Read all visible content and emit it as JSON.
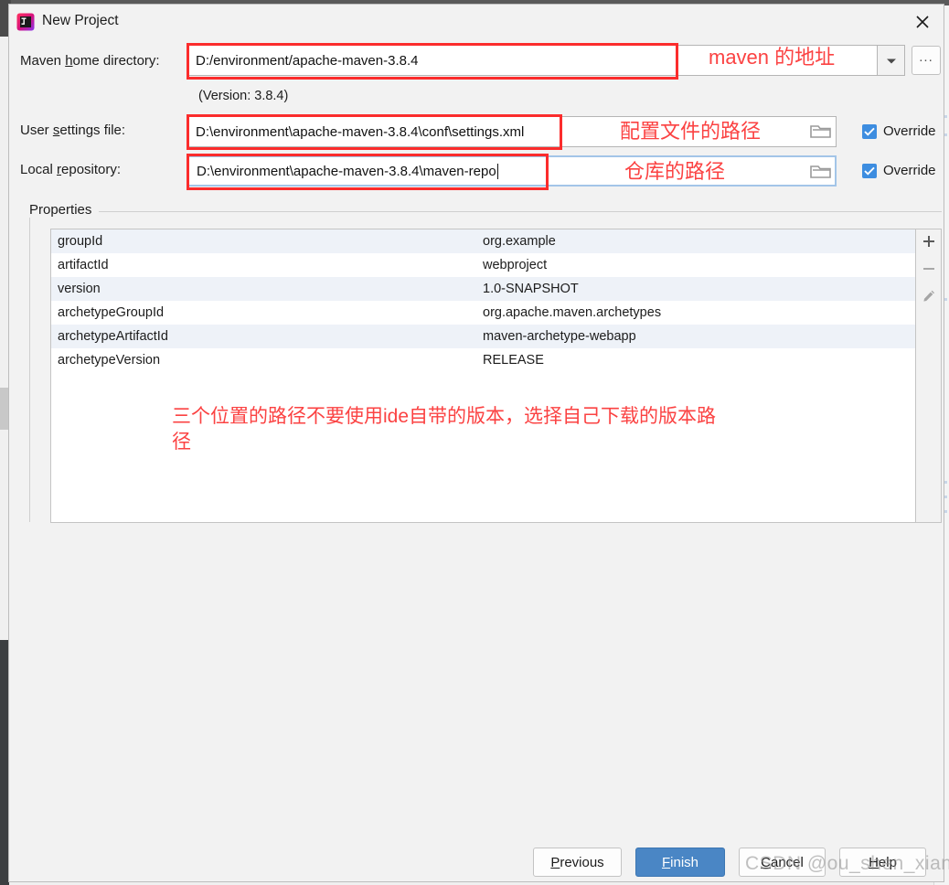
{
  "window": {
    "title": "New Project",
    "app_icon": "intellij-idea-icon",
    "close_icon": "close-icon"
  },
  "form": {
    "maven_home": {
      "label_pre": "Maven ",
      "label_accel": "h",
      "label_post": "ome directory:",
      "value": "D:/environment/apache-maven-3.8.4",
      "dropdown_icon": "chevron-down-icon",
      "browse_label": "...",
      "annotation": "maven 的地址"
    },
    "version_note": "(Version: 3.8.4)",
    "user_settings": {
      "label_pre": "User ",
      "label_accel": "s",
      "label_post": "ettings file:",
      "value": "D:\\environment\\apache-maven-3.8.4\\conf\\settings.xml",
      "folder_icon": "folder-icon",
      "override_label": "Override",
      "override_checked": true,
      "annotation": "配置文件的路径"
    },
    "local_repository": {
      "label_pre": "Local ",
      "label_accel": "r",
      "label_post": "epository:",
      "value": "D:\\environment\\apache-maven-3.8.4\\maven-repo",
      "folder_icon": "folder-icon",
      "override_label": "Override",
      "override_checked": true,
      "annotation": "仓库的路径"
    }
  },
  "properties": {
    "legend": "Properties",
    "rows": [
      {
        "key": "groupId",
        "value": "org.example"
      },
      {
        "key": "artifactId",
        "value": "webproject"
      },
      {
        "key": "version",
        "value": "1.0-SNAPSHOT"
      },
      {
        "key": "archetypeGroupId",
        "value": "org.apache.maven.archetypes"
      },
      {
        "key": "archetypeArtifactId",
        "value": "maven-archetype-webapp"
      },
      {
        "key": "archetypeVersion",
        "value": "RELEASE"
      }
    ],
    "toolbar": {
      "add_icon": "plus-icon",
      "remove_icon": "minus-icon",
      "edit_icon": "pencil-icon"
    }
  },
  "annotations": {
    "main_note": "三个位置的路径不要使用ide自带的版本，选择自己下载的版本路径"
  },
  "footer": {
    "previous": {
      "pre": "",
      "accel": "P",
      "post": "revious"
    },
    "finish": {
      "pre": "",
      "accel": "F",
      "post": "inish"
    },
    "cancel": {
      "pre": "",
      "accel": "C",
      "post": "ancel"
    },
    "help": {
      "pre": "",
      "accel": "H",
      "post": "elp"
    }
  },
  "watermark": "CSDN @ou_shen_xian",
  "colors": {
    "accent_blue": "#4a86c5",
    "checkbox_blue": "#3d8de0",
    "annotation_red": "#fb4242",
    "highlight_box_red": "#fb2c2c",
    "row_alt": "#eef2f8"
  }
}
